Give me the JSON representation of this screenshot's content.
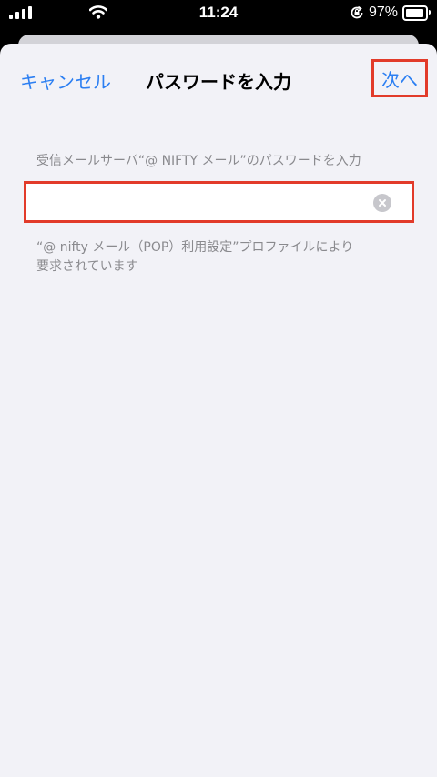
{
  "status_bar": {
    "time": "11:24",
    "battery_percent": "97%",
    "battery_level": 0.97,
    "icons": [
      "cellular-signal-icon",
      "wifi-icon",
      "orientation-lock-icon",
      "battery-icon"
    ]
  },
  "nav": {
    "cancel_label": "キャンセル",
    "title": "パスワードを入力",
    "next_label": "次へ"
  },
  "form": {
    "section_header": "受信メールサーバ“@ NIFTY メール”のパスワードを入力",
    "password_value": "",
    "footer_line1": "“@ nifty メール（POP）利用設定”プロファイルにより",
    "footer_line2": "要求されています"
  },
  "colors": {
    "accent": "#2c7ff2",
    "highlight_border": "#e23b2a",
    "background": "#f2f2f7",
    "secondary_text": "#8a8a8e"
  }
}
